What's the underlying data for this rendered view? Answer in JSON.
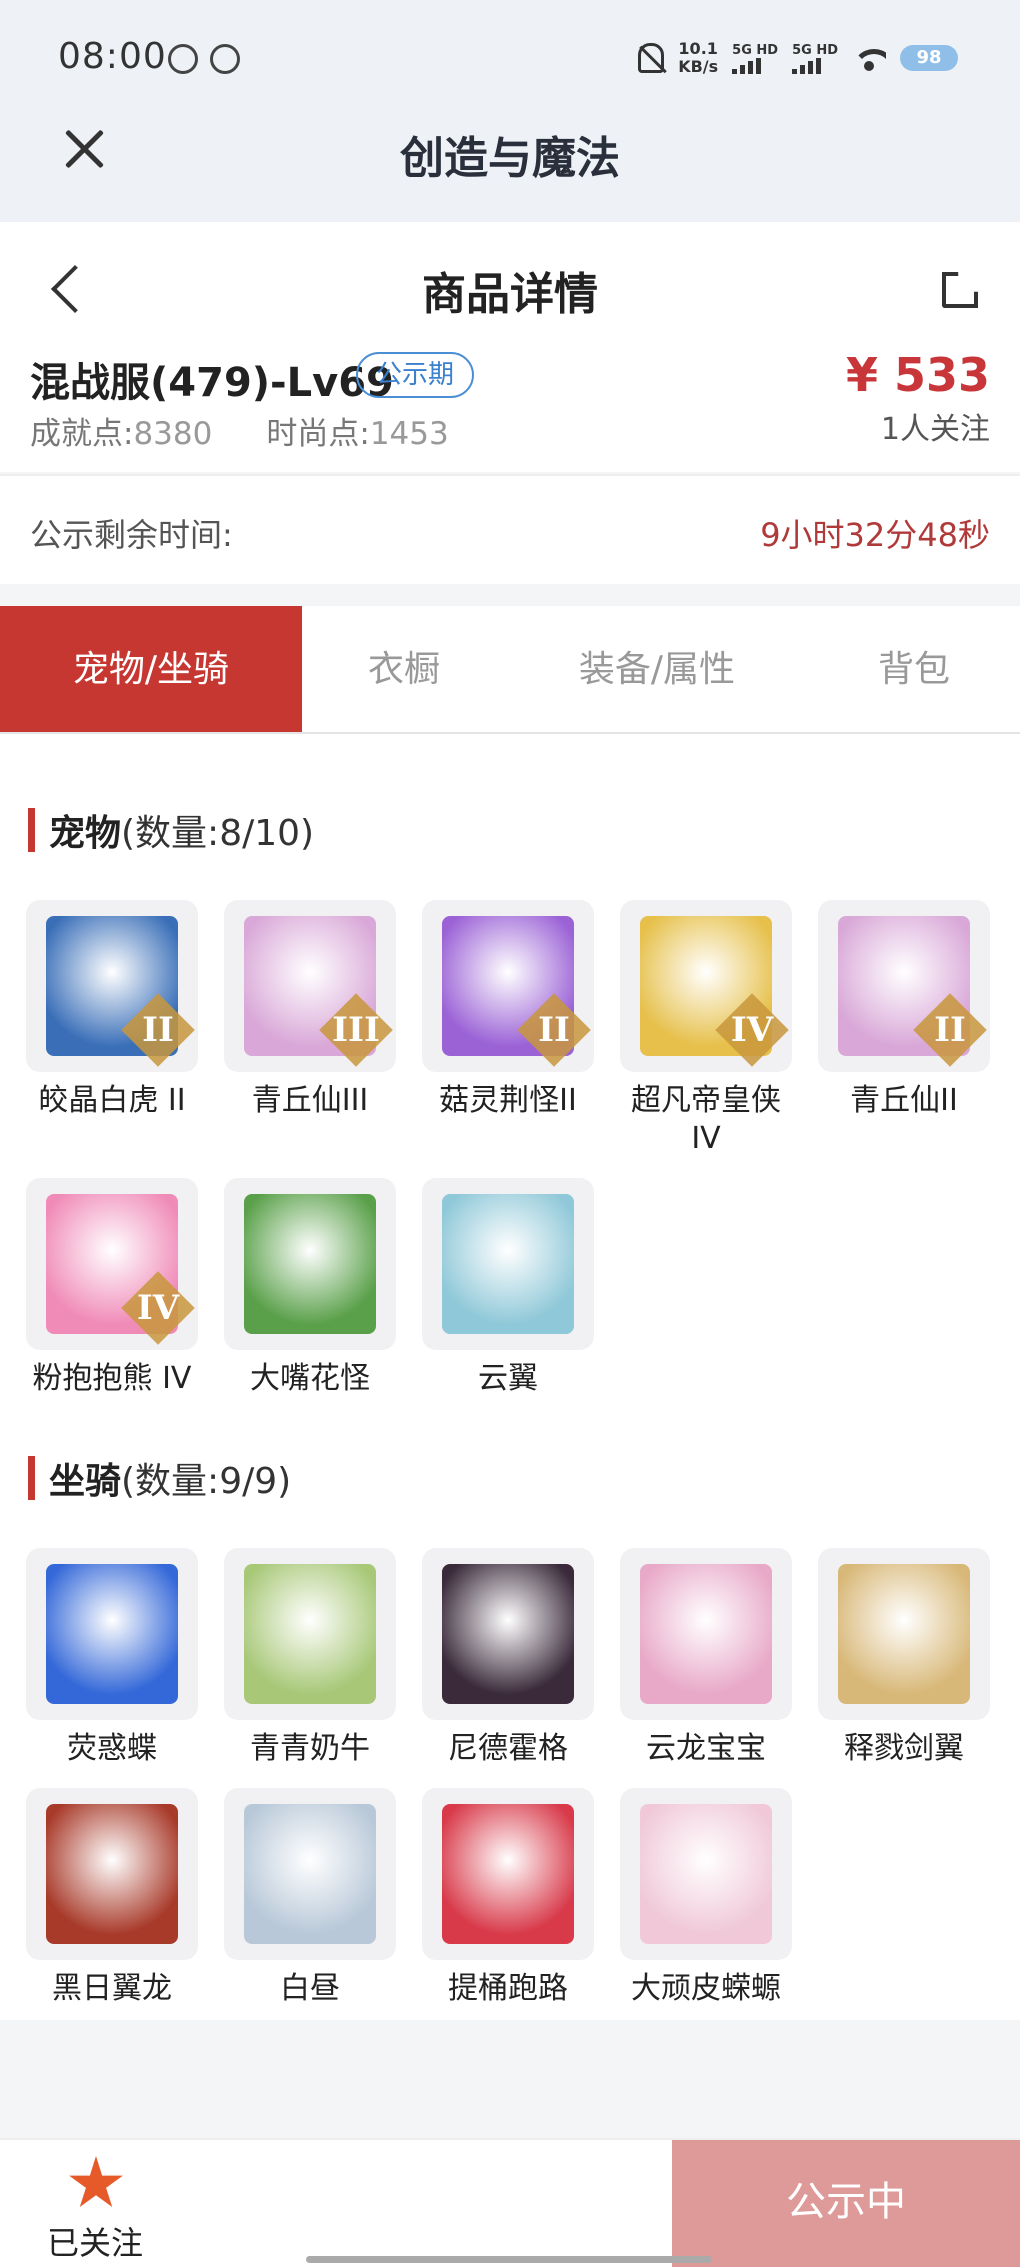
{
  "status": {
    "time": "08:00",
    "netspeed_value": "10.1",
    "netspeed_unit": "KB/s",
    "sim1": "5G HD",
    "sim2": "5G HD",
    "battery": "98"
  },
  "appbar": {
    "title": "创造与魔法"
  },
  "header": {
    "title": "商品详情",
    "server": "混战服(479)-Lv69",
    "tag": "公示期",
    "price": "¥ 533",
    "followers": "1人关注",
    "achievement_label": "成就点:",
    "achievement_value": "8380",
    "fashion_label": "时尚点:",
    "fashion_value": "1453"
  },
  "countdown": {
    "label": "公示剩余时间:",
    "value": "9小时32分48秒"
  },
  "tabs": [
    {
      "label": "宠物/坐骑",
      "active": true
    },
    {
      "label": "衣橱",
      "active": false
    },
    {
      "label": "装备/属性",
      "active": false
    },
    {
      "label": "背包",
      "active": false
    }
  ],
  "pets": {
    "title": "宠物",
    "count": "(数量:8/10)",
    "items": [
      {
        "name": "皎晶白虎 II",
        "rank": "II",
        "color": "#3a6fb8"
      },
      {
        "name": "青丘仙III",
        "rank": "III",
        "color": "#d9a8d8"
      },
      {
        "name": "菇灵荆怪II",
        "rank": "II",
        "color": "#9b62d6"
      },
      {
        "name": "超凡帝皇侠IV",
        "rank": "IV",
        "color": "#e6c04a"
      },
      {
        "name": "青丘仙II",
        "rank": "II",
        "color": "#d9a8d8"
      },
      {
        "name": "粉抱抱熊 IV",
        "rank": "IV",
        "color": "#f08bb8"
      },
      {
        "name": "大嘴花怪",
        "rank": "",
        "color": "#5aa04a"
      },
      {
        "name": "云翼",
        "rank": "",
        "color": "#8fc8d8"
      }
    ]
  },
  "mounts": {
    "title": "坐骑",
    "count": "(数量:9/9)",
    "items": [
      {
        "name": "荧惑蝶",
        "color": "#3468d8"
      },
      {
        "name": "青青奶牛",
        "color": "#a8c878"
      },
      {
        "name": "尼德霍格",
        "color": "#3a2a3a"
      },
      {
        "name": "云龙宝宝",
        "color": "#e8a8c8"
      },
      {
        "name": "释戮剑翼",
        "color": "#d8b878"
      },
      {
        "name": "黑日翼龙",
        "color": "#a83a2a"
      },
      {
        "name": "白昼",
        "color": "#b8c8d8"
      },
      {
        "name": "提桶跑路",
        "color": "#d83a4a"
      },
      {
        "name": "大顽皮蝾螈",
        "color": "#f0c8d8"
      }
    ]
  },
  "bottom": {
    "follow_label": "已关注",
    "action_label": "公示中"
  }
}
